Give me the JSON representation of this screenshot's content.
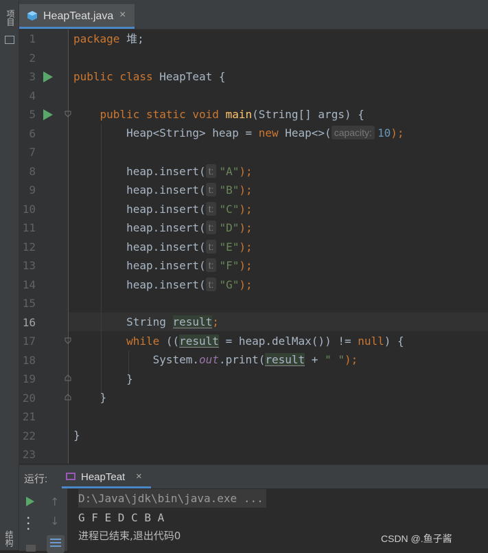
{
  "sidebar": {
    "project_label": "项目",
    "structure_label": "结构"
  },
  "tab": {
    "filename": "HeapTeat.java",
    "close": "×"
  },
  "editor": {
    "line_numbers": [
      "1",
      "2",
      "3",
      "4",
      "5",
      "6",
      "7",
      "8",
      "9",
      "10",
      "11",
      "12",
      "13",
      "14",
      "15",
      "16",
      "17",
      "18",
      "19",
      "20",
      "21",
      "22",
      "23"
    ],
    "current_line": "16",
    "code": {
      "l1_kw": "package",
      "l1_rest": " 堆;",
      "l3_kw": "public class",
      "l3_rest": " HeapTeat {",
      "l5_kw": "public static void",
      "l5_fn": "main",
      "l5_rest": "(String[] args) {",
      "l6_a": "Heap<String> heap = ",
      "l6_kw": "new",
      "l6_b": " Heap<>(",
      "l6_hint": "capacity:",
      "l6_num": "10",
      "l6_end": ");",
      "insert_call": "heap.insert(",
      "insert_hint": "t:",
      "insert_end": ");",
      "insert_args": [
        "\"A\"",
        "\"B\"",
        "\"C\"",
        "\"D\"",
        "\"E\"",
        "\"F\"",
        "\"G\""
      ],
      "l16_a": "String ",
      "l16_var": "result",
      "l16_end": ";",
      "l17_kw": "while",
      "l17_a": " ((",
      "l17_var": "result",
      "l17_b": " = heap.delMax()) != ",
      "l17_null": "null",
      "l17_c": ") {",
      "l18_a": "System.",
      "l18_field": "out",
      "l18_b": ".print(",
      "l18_var": "result",
      "l18_c": " + ",
      "l18_str": "\" \"",
      "l18_end": ");",
      "l19": "}",
      "l20": "}",
      "l22": "}"
    }
  },
  "run_panel": {
    "label": "运行:",
    "tab_name": "HeapTeat",
    "close": "×",
    "console": {
      "command": "D:\\Java\\jdk\\bin\\java.exe ...",
      "output": "G F E D C B A",
      "exit_message": "进程已结束,退出代码0"
    }
  },
  "watermark": "CSDN @.鱼子酱",
  "icons": {
    "run_gutter": "run-gutter-icon",
    "fold": "fold-icon",
    "java_file": "java-class-icon"
  },
  "colors": {
    "keyword": "#cc7832",
    "string": "#6a8759",
    "number": "#6897bb",
    "function": "#ffc66d",
    "field": "#9876aa",
    "run_green": "#59a869",
    "tab_accent": "#4a88c7"
  }
}
